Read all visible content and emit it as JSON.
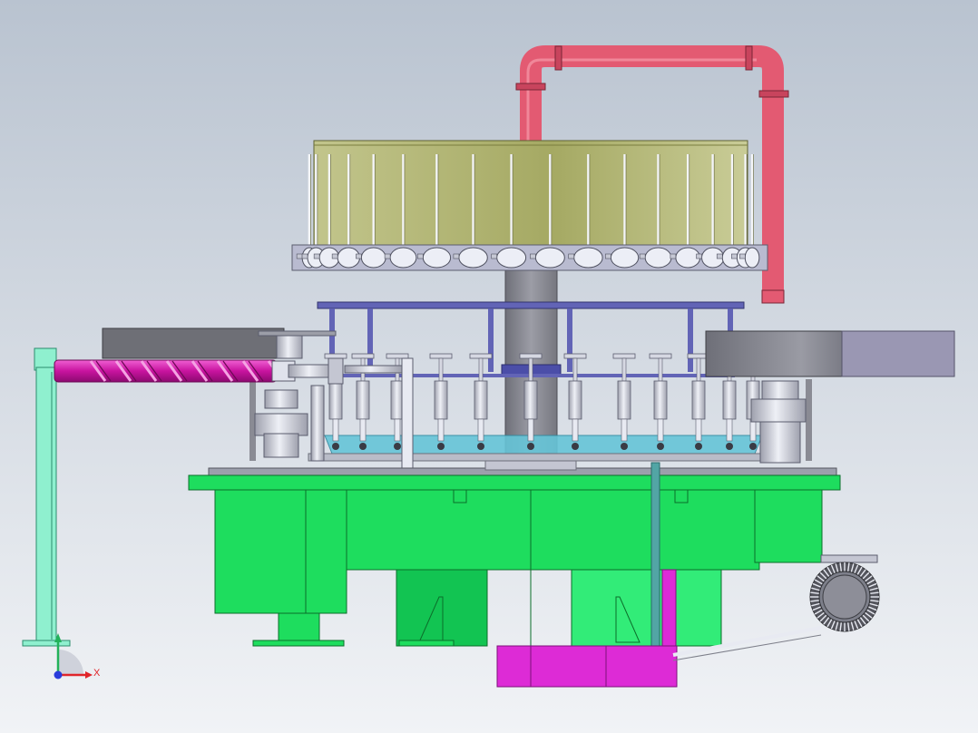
{
  "viewport": {
    "background_top": "#b9c3d0",
    "background_bottom": "#f1f3f6"
  },
  "model": {
    "colors": {
      "bowl": "#aaae6a",
      "bowl_dark": "#8f9450",
      "pipe": "#e35a72",
      "auger": "#d81fb0",
      "frame": "#1edd5e",
      "frame_light": "#32ec78",
      "frame_dark": "#12b94a",
      "rail": "#6264b6",
      "column": "#8d8e98",
      "tray": "#66c5d8",
      "base_block": "#dd2bd6",
      "mint_post": "#8ff0cf",
      "steel": "#c9cbd8",
      "dark_steel": "#7d7f8a"
    },
    "bowl_valve_count": 18,
    "filler_head_count": 12
  },
  "triad": {
    "x_label": "X",
    "y_label": "",
    "x_color": "#e0252a",
    "y_color": "#22b25a",
    "z_color": "#2a3cdc"
  }
}
